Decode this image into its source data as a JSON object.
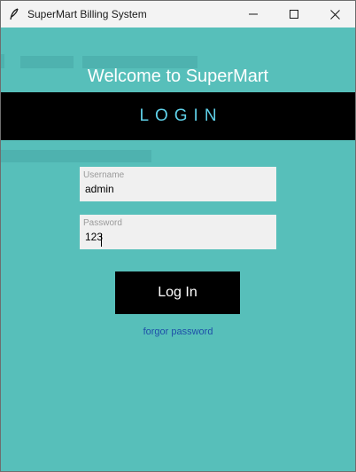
{
  "window": {
    "title": "SuperMart Billing System",
    "app_icon": "feather-icon",
    "controls": [
      "minimize-icon",
      "maximize-icon",
      "close-icon"
    ]
  },
  "main": {
    "welcome_text": "Welcome to SuperMart",
    "banner_text": "LOGIN",
    "username": {
      "label": "Username",
      "value": "admin"
    },
    "password": {
      "label": "Password",
      "value": "123"
    },
    "login_button": "Log In",
    "forgot_link": "forgor password"
  },
  "colors": {
    "background": "#57bfba",
    "banner": "#000000",
    "banner_text": "#5fd0e8",
    "link": "#1e4fa8"
  }
}
